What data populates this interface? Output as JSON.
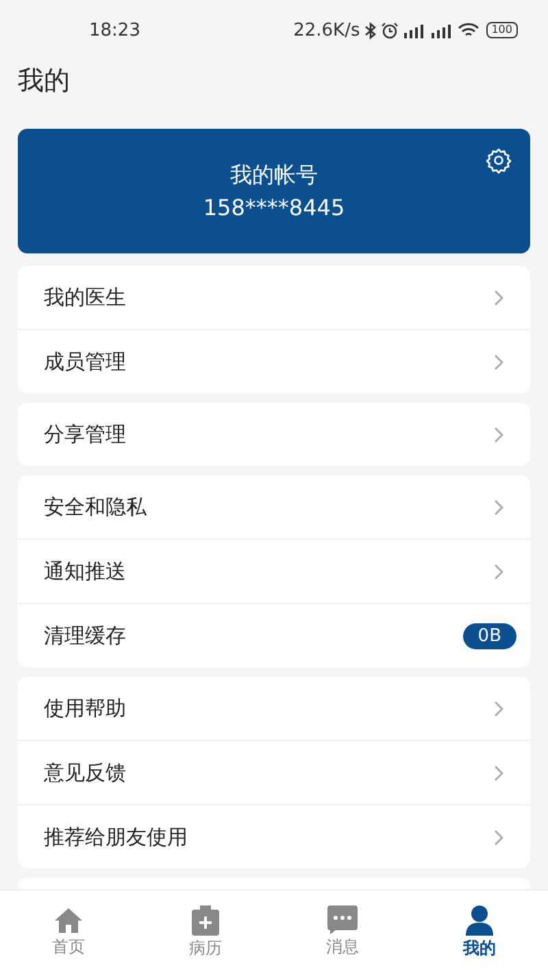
{
  "status_bar": {
    "time": "18:23",
    "speed": "22.6K/s",
    "battery": "100"
  },
  "header": {
    "title": "我的"
  },
  "account": {
    "title": "我的帐号",
    "phone": "158****8445"
  },
  "groups": [
    {
      "items": [
        {
          "label": "我的医生",
          "kind": "arrow"
        },
        {
          "label": "成员管理",
          "kind": "arrow"
        }
      ]
    },
    {
      "items": [
        {
          "label": "分享管理",
          "kind": "arrow"
        }
      ]
    },
    {
      "items": [
        {
          "label": "安全和隐私",
          "kind": "arrow"
        },
        {
          "label": "通知推送",
          "kind": "arrow"
        },
        {
          "label": "清理缓存",
          "kind": "badge",
          "value": "0B"
        }
      ]
    },
    {
      "items": [
        {
          "label": "使用帮助",
          "kind": "arrow"
        },
        {
          "label": "意见反馈",
          "kind": "arrow"
        },
        {
          "label": "推荐给朋友使用",
          "kind": "arrow"
        }
      ]
    }
  ],
  "tabs": [
    {
      "label": "首页",
      "kind": "home",
      "selected": false
    },
    {
      "label": "病历",
      "kind": "record",
      "selected": false
    },
    {
      "label": "消息",
      "kind": "message",
      "selected": false
    },
    {
      "label": "我的",
      "kind": "person",
      "selected": true
    }
  ]
}
